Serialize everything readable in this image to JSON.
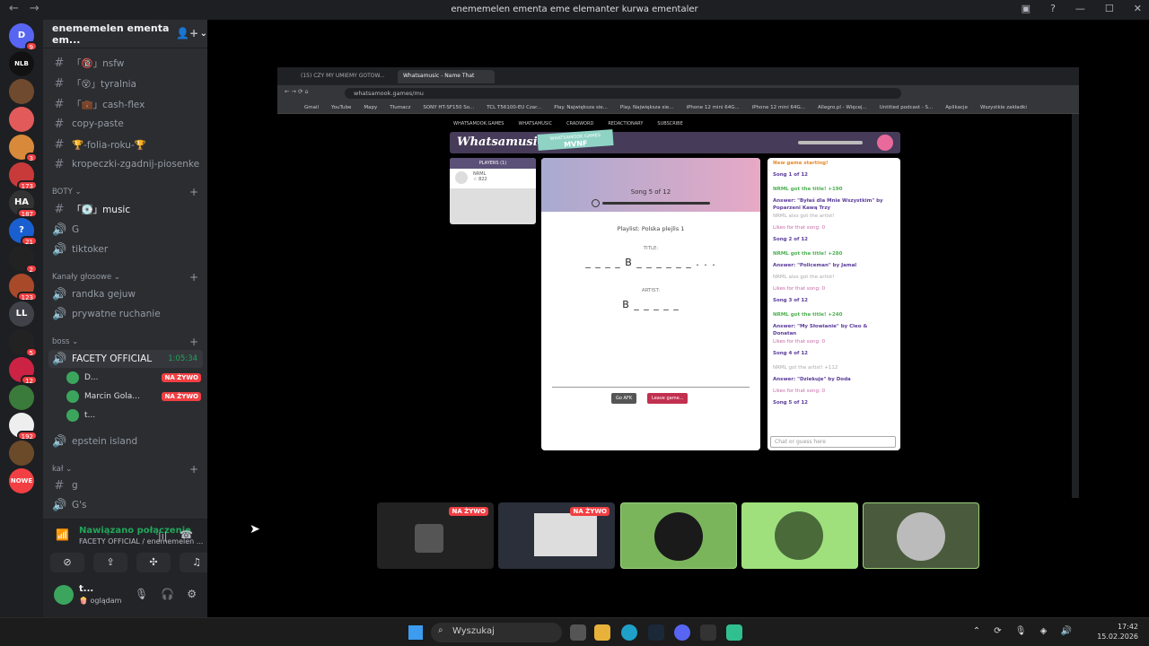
{
  "window": {
    "title": "enememelen ementa eme elemanter kurwa ementaler"
  },
  "server": {
    "name": "enememelen ementa em...",
    "chevron": "⌄"
  },
  "server_list": [
    {
      "label": "D",
      "badge": "9",
      "color": "#5865f2"
    },
    {
      "label": "NLB",
      "badge": "",
      "color": "#111"
    },
    {
      "label": "",
      "badge": "",
      "color": "#6f4a2e"
    },
    {
      "label": "",
      "badge": "",
      "color": "#e35a5a"
    },
    {
      "label": "",
      "badge": "3",
      "color": "#d88a3a"
    },
    {
      "label": "",
      "badge": "173",
      "color": "#c83a3a"
    },
    {
      "label": "HA",
      "badge": "187",
      "color": "#333"
    },
    {
      "label": "?",
      "badge": "21",
      "color": "#1a5fd0"
    },
    {
      "label": "",
      "badge": "2",
      "color": "#222"
    },
    {
      "label": "",
      "badge": "123",
      "color": "#a84a2a"
    },
    {
      "label": "LL",
      "badge": "",
      "color": "#404249"
    },
    {
      "label": "",
      "badge": "5",
      "color": "#222"
    },
    {
      "label": "",
      "badge": "12",
      "color": "#c24"
    },
    {
      "label": "",
      "badge": "",
      "color": "#3a7a3a"
    },
    {
      "label": "",
      "badge": "192",
      "color": "#eee"
    },
    {
      "label": "",
      "badge": "",
      "color": "#6b4a2a"
    },
    {
      "label": "NOWE",
      "badge": "",
      "color": "#f23f43"
    }
  ],
  "channels": {
    "nsfw": "「🔞」nsfw",
    "tyralnia": "「😵」tyralnia",
    "cashflex": "「💼」cash-flex",
    "copypaste": "copy-paste",
    "folia": "🏆-folia-roku-🏆",
    "kropeczki": "kropeczki-zgadnij-piosenke",
    "cat_boty": "BOTY",
    "music": "「💽」music",
    "g": "G",
    "tiktoker": "tiktoker",
    "cat_kanaly": "Kanały głosowe",
    "randka": "randka gejuw",
    "prywatne": "prywatne ruchanie",
    "cat_boss": "boss",
    "facety": "FACETY OFFICIAL",
    "facety_time": "1:05:34",
    "epstein": "epstein island",
    "cat_kal": "kał",
    "g2": "g",
    "gs": "G's"
  },
  "voice_users": [
    {
      "name": "D...",
      "live": "NA ŻYWO"
    },
    {
      "name": "Marcin Gola...",
      "live": "NA ŻYWO"
    },
    {
      "name": "t...",
      "live": ""
    }
  ],
  "voice": {
    "status": "Nawiązano połączenie",
    "channel": "FACETY OFFICIAL / enememelen ..."
  },
  "user": {
    "name": "t...",
    "status": "🍿 oglądam"
  },
  "browser": {
    "tab1": "(15) CZY MY UMIEMY GOTOW...",
    "tab2": "Whatsamusic - Name That",
    "url": "whatsamook.games/mu",
    "bookmarks": [
      "Gmail",
      "YouTube",
      "Mapy",
      "Tłumacz",
      "SONY HT-SF150 So...",
      "TCL T56100-EU Czar...",
      "Play. Największa sie...",
      "Play. Największa sie...",
      "iPhone 12 mini 64G...",
      "iPhone 12 mini 64G...",
      "Allegro.pl - Więcej...",
      "Untitled podcast - S...",
      "Aplikacje",
      "Wszystkie zakładki"
    ]
  },
  "site": {
    "nav": [
      "WHATSAMOOK.GAMES",
      "WHATSAMUSIC",
      "CRADWORD",
      "REDACTIONARY",
      "SUBSCRIBE"
    ],
    "logo": "Whatsamusic",
    "badge_top": "WHATSAMOOK.GAMES",
    "badge_bottom": "MVNF",
    "players_header": "PLAYERS (1)",
    "player_name": "NRML",
    "player_score": "☆ 822",
    "song": "Song 5 of 12",
    "playlist": "Playlist: Polska plejlis 1",
    "title_label": "TITLE:",
    "title_mask": "_ _ _ _    B _ _    _ _ _ _ . . .",
    "artist_label": "ARTIST:",
    "artist_mask": "B _ _ _ _ _",
    "afk": "Go AFK",
    "leave": "Leave game...",
    "chat_placeholder": "Chat or guess here"
  },
  "chat": [
    {
      "t": "New game starting!",
      "c": "c-or"
    },
    {
      "t": "Song 1 of 12",
      "c": "c-pu"
    },
    {
      "t": "NRML got the title! +190",
      "c": "c-gr"
    },
    {
      "t": "Answer: \"Byłaś dla Mnie Wszystkim\" by Poparzeni Kawą Trzy",
      "c": "c-pu"
    },
    {
      "t": "NRML also got the artist!",
      "c": "c-gy"
    },
    {
      "t": "Likes for that song: 0",
      "c": "c-pk"
    },
    {
      "t": "Song 2 of 12",
      "c": "c-pu"
    },
    {
      "t": "NRML got the title! +280",
      "c": "c-gr"
    },
    {
      "t": "Answer: \"Policeman\" by Jamal",
      "c": "c-pu"
    },
    {
      "t": "NRML also got the artist!",
      "c": "c-gy"
    },
    {
      "t": "Likes for that song: 0",
      "c": "c-pk"
    },
    {
      "t": "Song 3 of 12",
      "c": "c-pu"
    },
    {
      "t": "NRML got the title! +240",
      "c": "c-gr"
    },
    {
      "t": "Answer: \"My Słowianie\" by Cleo & Donatan",
      "c": "c-pu"
    },
    {
      "t": "Likes for that song: 0",
      "c": "c-pk"
    },
    {
      "t": "Song 4 of 12",
      "c": "c-pu"
    },
    {
      "t": "NRML got the artist! +112",
      "c": "c-gy"
    },
    {
      "t": "Answer: \"Dziekuje\" by Doda",
      "c": "c-pu"
    },
    {
      "t": "Likes for that song: 0",
      "c": "c-pk"
    },
    {
      "t": "Song 5 of 12",
      "c": "c-pu"
    }
  ],
  "tiles": {
    "live1": "NA ŻYWO",
    "live2": "NA ŻYWO"
  },
  "taskbar": {
    "search": "Wyszukaj",
    "time": "17:42",
    "date": "15.02.2026"
  }
}
